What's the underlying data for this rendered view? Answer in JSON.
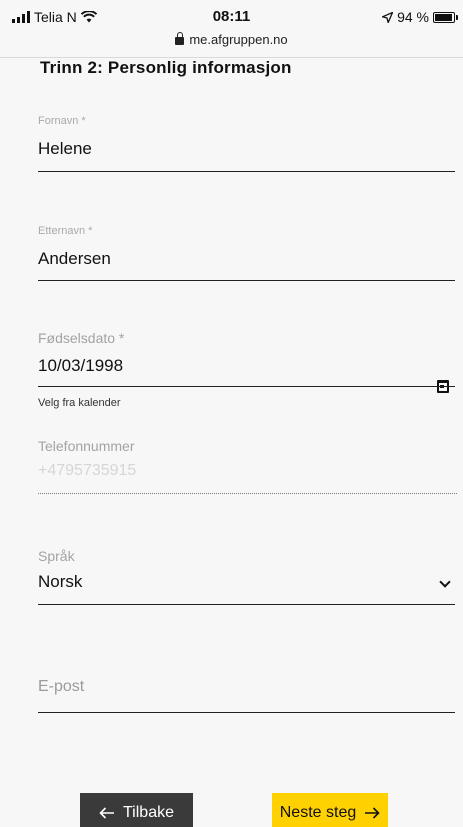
{
  "status_bar": {
    "carrier": "Telia N",
    "time": "08:11",
    "battery": "94 %",
    "url": "me.afgruppen.no"
  },
  "page": {
    "step_title": "Trinn 2: Personlig informasjon"
  },
  "form": {
    "first_name": {
      "label": "Fornavn *",
      "value": "Helene"
    },
    "last_name": {
      "label": "Etternavn *",
      "value": "Andersen"
    },
    "birth_date": {
      "label": "Fødselsdato *",
      "value": "10/03/1998",
      "hint": "Velg fra kalender"
    },
    "phone": {
      "label": "Telefonnummer",
      "placeholder": "+4795735915"
    },
    "language": {
      "label": "Språk",
      "value": "Norsk"
    },
    "email": {
      "placeholder": "E-post"
    }
  },
  "actions": {
    "back_label": "Tilbake",
    "next_label": "Neste steg"
  },
  "colors": {
    "next_button_bg": "#ffd100",
    "back_button_bg": "#3a3a3a"
  }
}
